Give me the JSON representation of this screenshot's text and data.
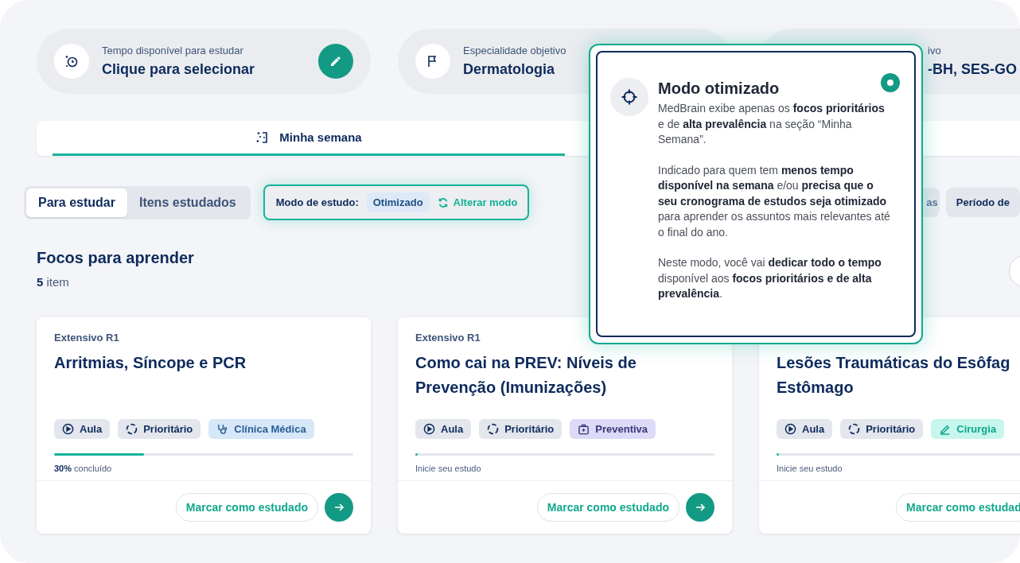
{
  "summary_cards": [
    {
      "kind": "time",
      "label": "Tempo disponível para estudar",
      "value": "Clique para selecionar",
      "editable": true
    },
    {
      "kind": "target",
      "label": "Especialidade objetivo",
      "value": "Dermatologia"
    },
    {
      "kind": "partial",
      "label": "ivo",
      "value": "-BH, SES-GO"
    }
  ],
  "tabs": [
    {
      "label": "Minha semana",
      "selected": true
    }
  ],
  "view_toggle": [
    {
      "label": "Para estudar",
      "selected": true
    },
    {
      "label": "Itens estudados",
      "selected": false
    }
  ],
  "study_mode": {
    "label": "Modo de estudo:",
    "value": "Otimizado",
    "action": "Alterar modo"
  },
  "filters": [
    {
      "label": "as"
    },
    {
      "label": "Período de"
    }
  ],
  "section": {
    "title": "Focos para aprender",
    "count": "**5** item"
  },
  "cards": [
    {
      "kicker": "Extensivo R1",
      "title": "Arritmias, Síncope e PCR",
      "tags": [
        {
          "kind": "lesson",
          "label": "Aula"
        },
        {
          "kind": "priority",
          "label": "Prioritário"
        },
        {
          "kind": "clinic",
          "label": "Clínica Médica"
        }
      ],
      "level": 0.3,
      "progress_text": "**30%** concluído",
      "button": "Marcar como estudado",
      "next_button": true
    },
    {
      "kicker": "Extensivo R1",
      "title": "Como cai na PREV: Níveis de Prevenção (Imunizações)",
      "tags": [
        {
          "kind": "lesson",
          "label": "Aula"
        },
        {
          "kind": "priority",
          "label": "Prioritário"
        },
        {
          "kind": "prevention",
          "label": "Preventiva"
        }
      ],
      "level": 0.005,
      "progress_text": "Inicie seu estudo",
      "button": "Marcar como estudado",
      "next_button": true
    },
    {
      "title": "Lesões Traumáticas do Esôfag\nEstômago",
      "tags": [
        {
          "kind": "lesson",
          "label": "Aula"
        },
        {
          "kind": "priority",
          "label": "Prioritário"
        },
        {
          "kind": "surgery",
          "label": "Cirurgia"
        }
      ],
      "level": 0.005,
      "progress_text": "Inicie seu estudo",
      "button": "Marcar como estudad"
    }
  ],
  "popover": {
    "title": "Modo otimizado",
    "selected": true,
    "paragraphs": [
      "MedBrain exibe apenas os **focos prioritários** e de **alta prevalência** na seção “Minha Semana”.",
      "Indicado para quem tem **menos tempo disponível na semana** e/ou **precisa que o seu cronograma de estudos seja otimizado** para aprender os assuntos mais relevantes até o final do ano.",
      "Neste modo, você vai **dedicar todo o tempo** disponível aos **focos prioritários e de alta prevalência**."
    ]
  }
}
